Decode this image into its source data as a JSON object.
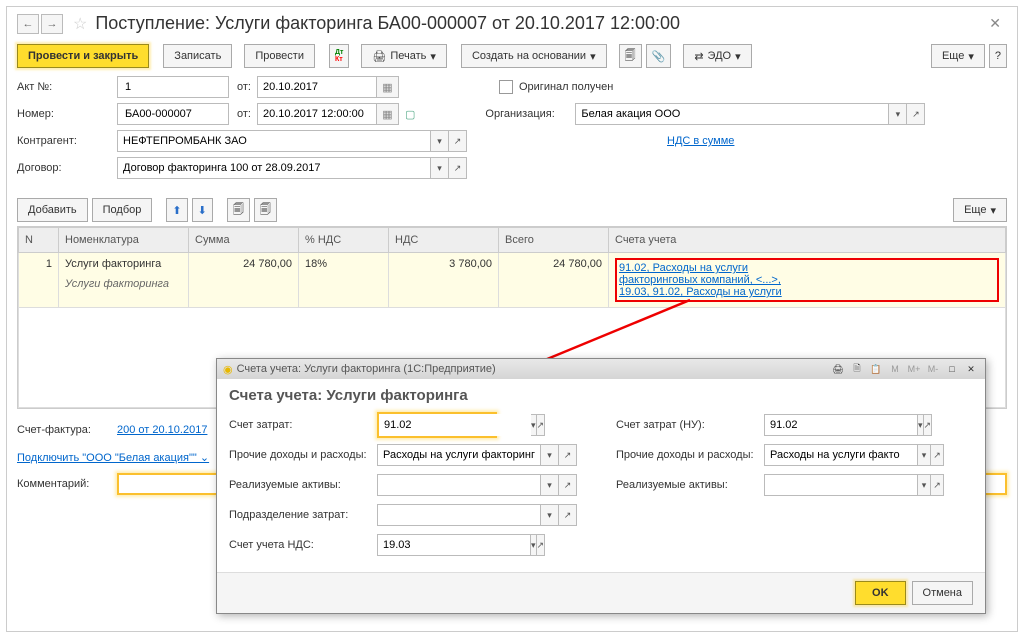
{
  "title": "Поступление: Услуги факторинга БА00-000007 от 20.10.2017 12:00:00",
  "toolbar": {
    "post_close": "Провести и закрыть",
    "write": "Записать",
    "post": "Провести",
    "print": "Печать",
    "create_based": "Создать на основании",
    "edo": "ЭДО",
    "more": "Еще",
    "help": "?"
  },
  "fields": {
    "act_no_label": "Акт №:",
    "act_no": "1",
    "act_date_from": "от:",
    "act_date": "20.10.2017",
    "number_label": "Номер:",
    "number": "БА00-000007",
    "number_from": "от:",
    "number_date": "20.10.2017 12:00:00",
    "original_received": "Оригинал получен",
    "org_label": "Организация:",
    "org": "Белая акация ООО",
    "contractor_label": "Контрагент:",
    "contractor": "НЕФТЕПРОМБАНК ЗАО",
    "vat_link": "НДС в сумме",
    "contract_label": "Договор:",
    "contract": "Договор факторинга 100 от 28.09.2017"
  },
  "table_toolbar": {
    "add": "Добавить",
    "pick": "Подбор",
    "more": "Еще"
  },
  "columns": {
    "n": "N",
    "nomenclature": "Номенклатура",
    "sum": "Сумма",
    "vat_pct": "% НДС",
    "vat": "НДС",
    "total": "Всего",
    "accounts": "Счета учета"
  },
  "row": {
    "n": "1",
    "nom": "Услуги факторинга",
    "nom2": "Услуги факторинга",
    "sum": "24 780,00",
    "vat_pct": "18%",
    "vat": "3 780,00",
    "total": "24 780,00",
    "acc1": "91.02, Расходы на услуги",
    "acc2": "факторинговых компаний, <...>,",
    "acc3": "19.03, 91.02, Расходы на услуги"
  },
  "footer": {
    "invoice_label": "Счет-фактура:",
    "invoice_link": "200 от 20.10.2017",
    "connect_link": "Подключить \"ООО \"Белая акация\"\" ⌄",
    "comment_label": "Комментарий:"
  },
  "popup": {
    "titlebar": "Счета учета: Услуги факторинга  (1С:Предприятие)",
    "heading": "Счета учета: Услуги факторинга",
    "left": {
      "account_label": "Счет затрат:",
      "account": "91.02",
      "income_label": "Прочие доходы и расходы:",
      "income": "Расходы на услуги факторинг",
      "assets_label": "Реализуемые активы:",
      "dept_label": "Подразделение затрат:",
      "vat_acc_label": "Счет учета НДС:",
      "vat_acc": "19.03"
    },
    "right": {
      "account_label": "Счет затрат (НУ):",
      "account": "91.02",
      "income_label": "Прочие доходы и расходы:",
      "income": "Расходы на услуги факто",
      "assets_label": "Реализуемые активы:"
    },
    "ok": "OK",
    "cancel": "Отмена"
  }
}
